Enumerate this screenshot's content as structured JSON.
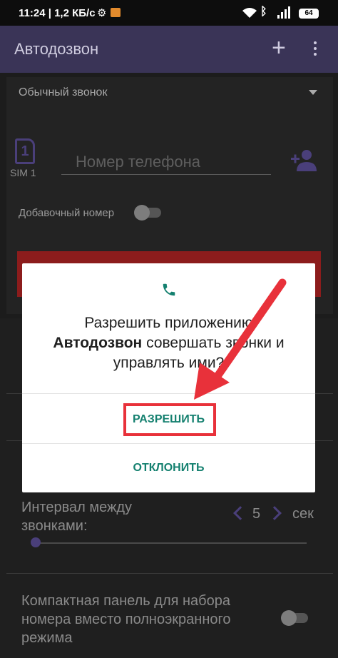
{
  "status_bar": {
    "time": "11:24",
    "net_speed": "1,2 КБ/с",
    "battery": "64"
  },
  "app_bar": {
    "title": "Автодозвон"
  },
  "main": {
    "call_type": "Обычный звонок",
    "sim_label": "SIM 1",
    "phone_placeholder": "Номер телефона",
    "extension_label": "Добавочный номер",
    "interval_label": "Интервал между звонками:",
    "interval_value": "5",
    "interval_unit": "сек",
    "compact_label": "Компактная панель для набора номера вместо полноэкранного режима"
  },
  "dialog": {
    "question_prefix": "Разрешить приложению",
    "app_name": "Автодозвон",
    "question_suffix": "совершать звонки и управлять ими?",
    "allow_label": "РАЗРЕШИТЬ",
    "deny_label": "ОТКЛОНИТЬ"
  },
  "colors": {
    "app_bar": "#3a3457",
    "accent": "#4a3f7a",
    "dialog_button": "#14806f",
    "highlight": "#e8313a",
    "call_button": "#8c1c1c"
  }
}
